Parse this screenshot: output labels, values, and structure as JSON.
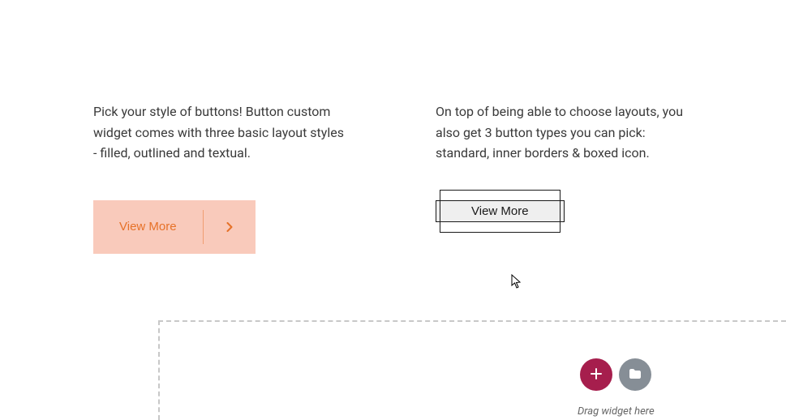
{
  "columns": {
    "left": {
      "description": "Pick your style of buttons! Button custom widget comes with three basic layout styles - filled, outlined and textual.",
      "button_label": "View More"
    },
    "right": {
      "description": "On top of being able to choose layouts, you also get 3 button types you can pick: standard, inner borders & boxed icon.",
      "button_label": "View More"
    }
  },
  "drop_zone": {
    "hint": "Drag widget here"
  },
  "colors": {
    "accent_orange": "#e67128",
    "accent_peach": "#f9cabb",
    "tool_primary": "#a61e4d",
    "tool_secondary": "#868e96"
  }
}
